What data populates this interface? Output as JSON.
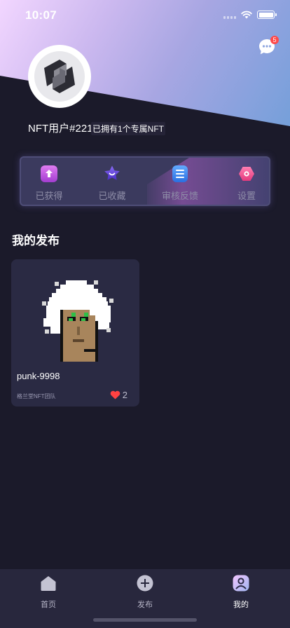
{
  "status": {
    "time": "10:07"
  },
  "header": {
    "message_badge": "5"
  },
  "profile": {
    "username": "NFT用户#221",
    "owned_text": "已拥有1个专属NFT"
  },
  "menu": [
    {
      "label": "已获得",
      "icon": "inbox-upload-icon",
      "color": "#c35be0"
    },
    {
      "label": "已收藏",
      "icon": "star-icon",
      "color": "#6b4fe0"
    },
    {
      "label": "审核反馈",
      "icon": "document-list-icon",
      "color": "#3e86ef"
    },
    {
      "label": "设置",
      "icon": "hexagon-settings-icon",
      "color": "#ef4b8f"
    }
  ],
  "section": {
    "title": "我的发布"
  },
  "cards": [
    {
      "title": "punk-9998",
      "team": "格兰堂NFT团队",
      "likes": "2"
    }
  ],
  "tabbar": [
    {
      "label": "首页",
      "icon": "home-icon",
      "active": false
    },
    {
      "label": "发布",
      "icon": "plus-circle-icon",
      "active": false
    },
    {
      "label": "我的",
      "icon": "user-icon",
      "active": true
    }
  ]
}
